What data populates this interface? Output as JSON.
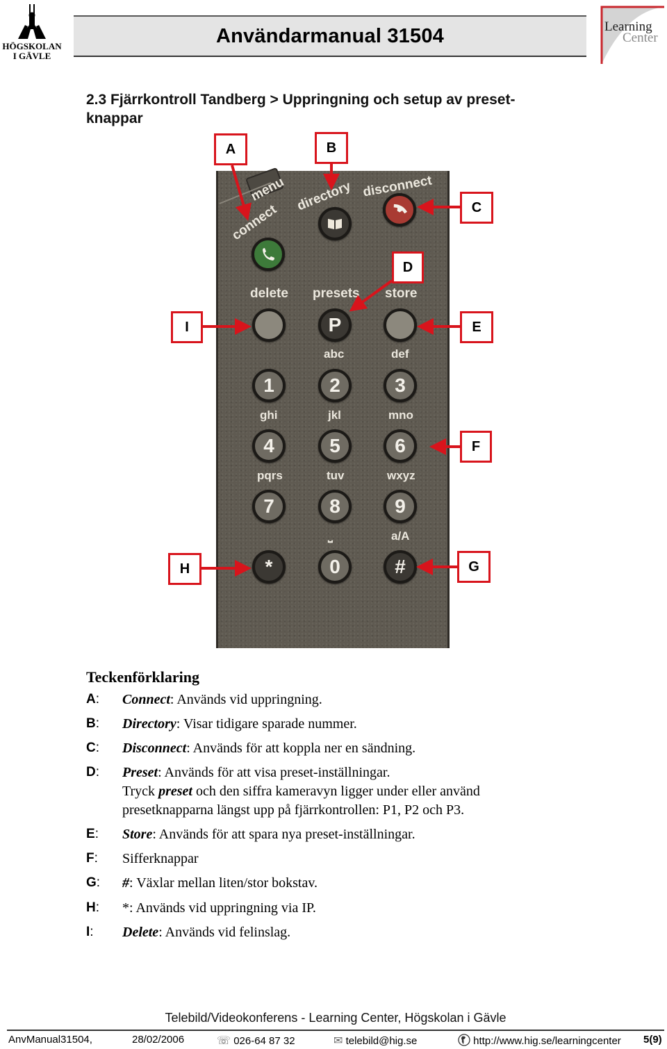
{
  "header": {
    "institution_line1": "HÖGSKOLAN",
    "institution_line2": "I GÄVLE",
    "title": "Användarmanual 31504",
    "logo_line1": "Learning",
    "logo_line2": "Center",
    "accent_color": "#d8141c"
  },
  "section": {
    "heading_line1": "2.3 Fjärrkontroll Tandberg > Uppringning och setup av preset-",
    "heading_line2": "knappar"
  },
  "remote": {
    "labels": {
      "menu": "menu",
      "connect": "connect",
      "directory": "directory",
      "disconnect": "disconnect",
      "delete": "delete",
      "presets": "presets",
      "store": "store"
    },
    "keys": {
      "connect": "phone-icon",
      "directory": "book-icon",
      "disconnect": "hangup-icon",
      "presets": "P",
      "k1": "1",
      "k2": "2",
      "k3": "3",
      "k4": "4",
      "k5": "5",
      "k6": "6",
      "k7": "7",
      "k8": "8",
      "k9": "9",
      "star": "*",
      "k0": "0",
      "hash": "#"
    },
    "sublabels": {
      "abc": "abc",
      "def": "def",
      "ghi": "ghi",
      "jkl": "jkl",
      "mno": "mno",
      "pqrs": "pqrs",
      "tuv": "tuv",
      "wxyz": "wxyz",
      "space": "⎵",
      "case": "a/A"
    },
    "callouts": {
      "A": "A",
      "B": "B",
      "C": "C",
      "D": "D",
      "E": "E",
      "F": "F",
      "G": "G",
      "H": "H",
      "I": "I"
    }
  },
  "legend": {
    "title": "Teckenförklaring",
    "items": [
      {
        "key": "A",
        "term": "Connect",
        "text": ": Används vid uppringning."
      },
      {
        "key": "B",
        "term": "Directory",
        "text": ": Visar tidigare sparade nummer."
      },
      {
        "key": "C",
        "term": "Disconnect",
        "text": ": Används för att koppla ner en sändning."
      },
      {
        "key": "D",
        "term": "Preset",
        "text": ": Används för att visa preset-inställningar."
      },
      {
        "key": "E",
        "term": "Store",
        "text": ": Används för att spara nya preset-inställningar."
      },
      {
        "key": "F",
        "term": "",
        "text": "Sifferknappar"
      },
      {
        "key": "G",
        "term": "#",
        "text": ": Växlar mellan liten/stor bokstav."
      },
      {
        "key": "H",
        "term": "",
        "text": "*:  Används vid uppringning via IP."
      },
      {
        "key": "I",
        "term": "Delete",
        "text": ": Används vid felinslag."
      }
    ],
    "preset_extra_line1_pre": "Tryck ",
    "preset_extra_line1_term": "preset",
    "preset_extra_line1_post": " och den siffra kameravyn ligger under eller använd",
    "preset_extra_line2": "presetknapparna längst upp på fjärrkontrollen: P1, P2 och P3."
  },
  "footer": {
    "title": "Telebild/Videokonferens - Learning Center, Högskolan i Gävle",
    "doc_id": "AnvManual31504,",
    "date": "28/02/2006",
    "phone_icon": "phone-icon",
    "phone": "026-64 87 32",
    "email_icon": "envelope-icon",
    "email": "telebild@hig.se",
    "web_icon": "globe-icon",
    "url": "http://www.hig.se/learningcenter",
    "page": "5(9)"
  }
}
